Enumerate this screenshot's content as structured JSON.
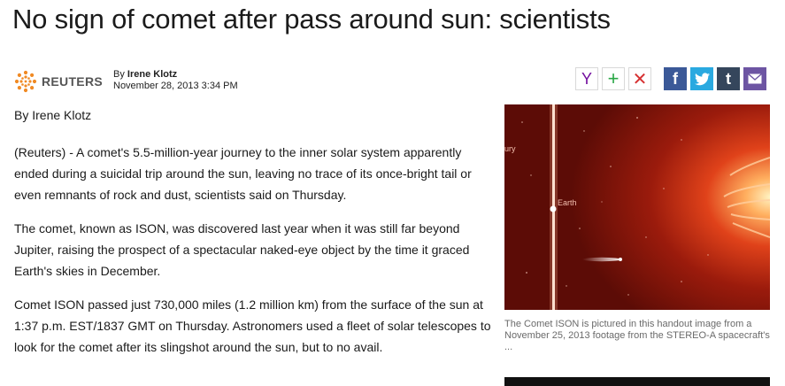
{
  "headline": "No sign of comet after pass around sun: scientists",
  "source": {
    "name": "REUTERS",
    "byline_prefix": "By",
    "author": "Irene Klotz",
    "date": "November 28, 2013 3:34 PM"
  },
  "share": [
    {
      "name": "yahoo",
      "label": "Y"
    },
    {
      "name": "add",
      "label": "+"
    },
    {
      "name": "close",
      "label": "✕"
    },
    {
      "name": "facebook",
      "label": "f"
    },
    {
      "name": "twitter",
      "label": "t"
    },
    {
      "name": "tumblr",
      "label": "t"
    },
    {
      "name": "email",
      "label": "✉"
    }
  ],
  "article": {
    "author_line": "By Irene Klotz",
    "paragraphs": [
      "(Reuters) - A comet's 5.5-million-year journey to the inner solar system apparently ended during a suicidal trip around the sun, leaving no trace of its once-bright tail or even remnants of rock and dust, scientists said on Thursday.",
      "The comet, known as ISON, was discovered last year when it was still far beyond Jupiter, raising the prospect of a spectacular naked-eye object by the time it graced Earth's skies in December.",
      "Comet ISON passed just 730,000 miles (1.2 million km) from the surface of the sun at 1:37 p.m. EST/1837 GMT on Thursday. Astronomers used a fleet of solar telescopes to look for the comet after its slingshot around the sun, but to no avail."
    ]
  },
  "figure": {
    "image_labels": {
      "mercury": "ury",
      "earth": "Earth"
    },
    "caption": "The Comet ISON is pictured in this handout image from a November 25, 2013 footage from the STEREO-A spacecraft's ..."
  },
  "colors": {
    "yahoo": "#720e9e",
    "facebook": "#3b5998",
    "twitter": "#2aa9e0",
    "tumblr": "#35465c",
    "email": "#6d55a3",
    "reuters_orange": "#f08a24"
  }
}
